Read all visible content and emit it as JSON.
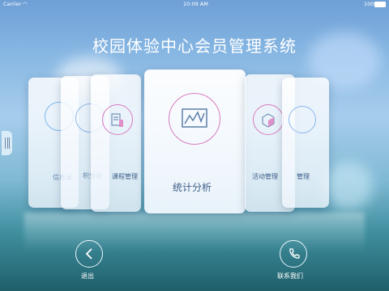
{
  "status_bar": {
    "carrier": "Carrier",
    "time": "10:09 AM",
    "battery": "100%"
  },
  "app_title": "校园体验中心会员管理系统",
  "cards": {
    "far_left_label": "信息录",
    "left_label": "积分兑",
    "left_near_label": "课程管理",
    "center_label": "统计分析",
    "right_near_label": "活动管理",
    "right_label": "管理"
  },
  "bottom_nav": {
    "exit_label": "退出",
    "contact_label": "联系我们"
  }
}
